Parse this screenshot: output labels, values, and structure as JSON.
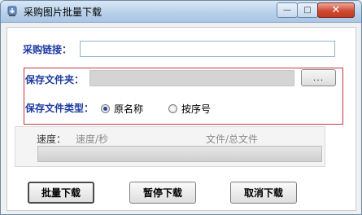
{
  "window": {
    "title": "采购图片批量下载",
    "controls": {
      "minimize": "—",
      "maximize": "□",
      "close": "✕"
    }
  },
  "form": {
    "url_label": "采购链接：",
    "url_value": "",
    "folder_label": "保存文件夹：",
    "folder_value": "",
    "browse_label": "...",
    "type_label": "保存文件类型：",
    "options": [
      {
        "label": "原名称",
        "selected": true
      },
      {
        "label": "按序号",
        "selected": false
      }
    ]
  },
  "status": {
    "speed_label": "速度：",
    "speed_value": "速度/秒",
    "files_value": "文件/总文件",
    "progress": 0
  },
  "buttons": {
    "download": "批量下载",
    "pause": "暂停下载",
    "cancel": "取消下载"
  },
  "colors": {
    "label": "#1e3aa0",
    "highlight_border": "#c4393e",
    "close_button": "#c23a22"
  },
  "icons": {
    "app": "download-app-icon"
  }
}
